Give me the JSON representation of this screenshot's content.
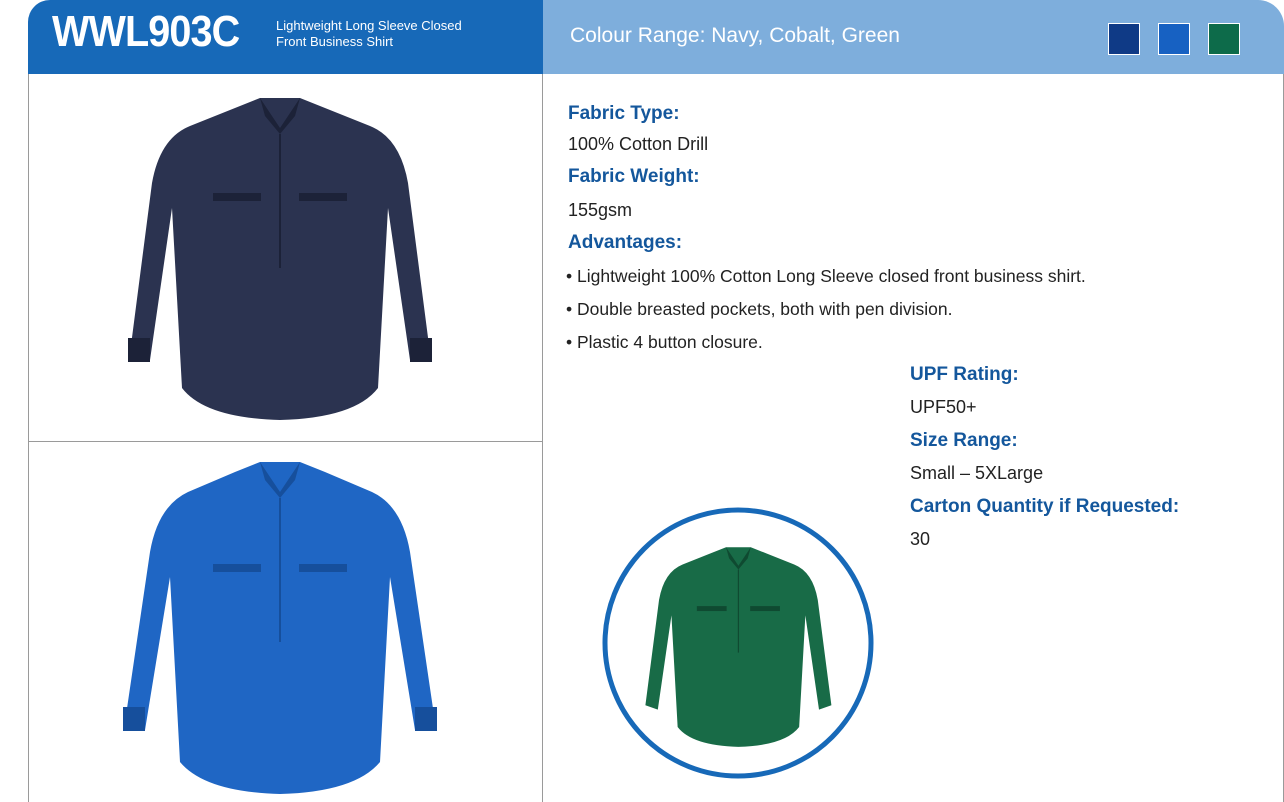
{
  "header": {
    "code": "WWL903C",
    "subtitle_line1": "Lightweight Long Sleeve Closed",
    "subtitle_line2": "Front Business Shirt",
    "colour_range": "Colour Range: Navy, Cobalt, Green",
    "swatches": [
      {
        "name": "Navy",
        "color": "#0f3a86"
      },
      {
        "name": "Cobalt",
        "color": "#1761c2"
      },
      {
        "name": "Green",
        "color": "#0d6b4a"
      }
    ]
  },
  "specs": {
    "fabric_type_label": "Fabric Type:",
    "fabric_type_value": "100% Cotton Drill",
    "fabric_weight_label": "Fabric Weight:",
    "fabric_weight_value": "155gsm",
    "advantages_label": "Advantages:",
    "advantages": [
      "• Lightweight 100% Cotton Long Sleeve closed front business shirt.",
      "• Double breasted pockets, both with pen division.",
      "• Plastic 4 button closure."
    ],
    "upf_label": "UPF Rating:",
    "upf_value": "UPF50+",
    "size_label": "Size Range:",
    "size_value": "Small – 5XLarge",
    "carton_label": "Carton Quantity if Requested:",
    "carton_value": "30"
  },
  "images": {
    "navy_shirt": {
      "color": "#2b3350",
      "shade": "#1c2238"
    },
    "cobalt_shirt": {
      "color": "#1f66c4",
      "shade": "#164f9c"
    },
    "green_shirt": {
      "color": "#186b47",
      "shade": "#0f4a31"
    },
    "circle_color": "#1769b8"
  }
}
